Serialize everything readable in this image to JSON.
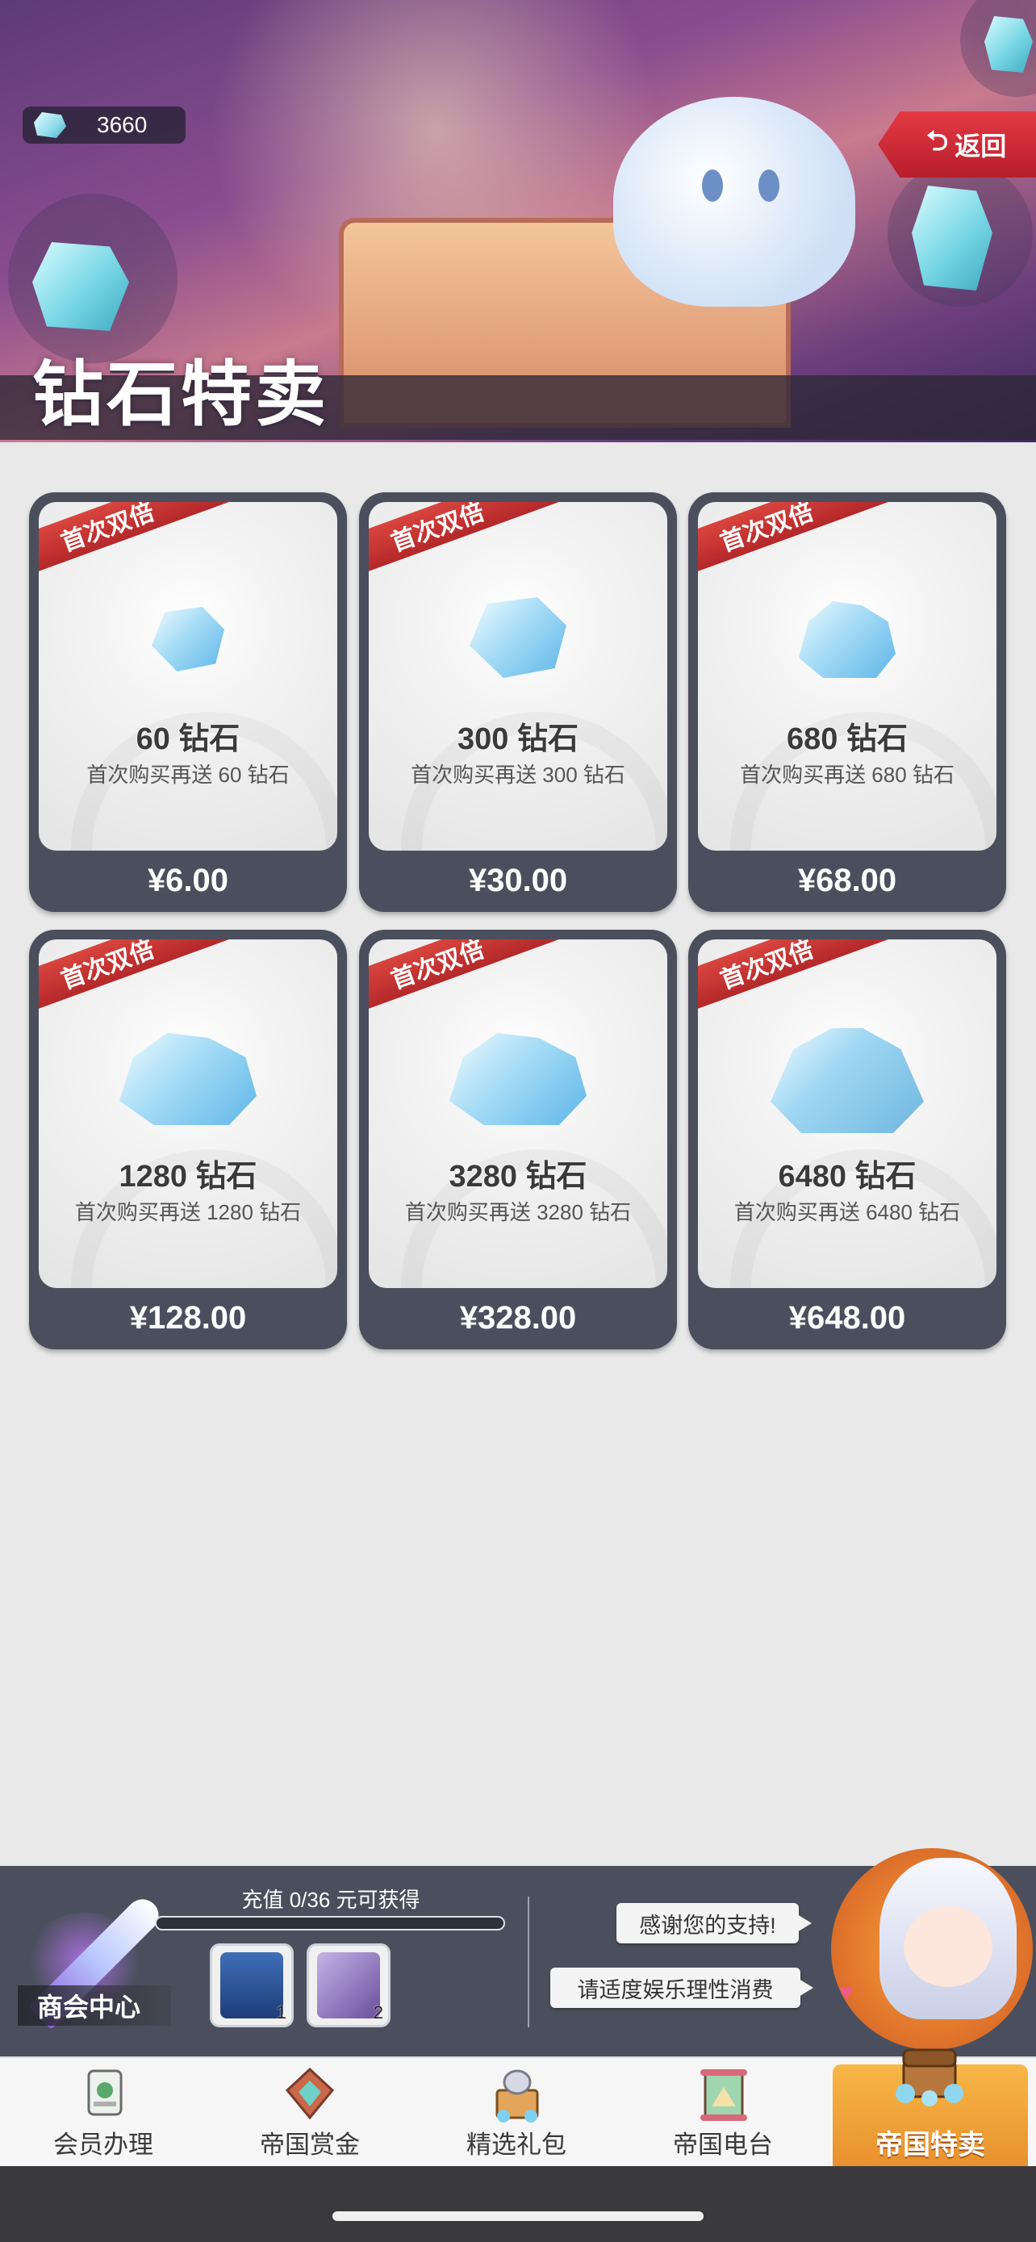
{
  "header": {
    "title": "钻石特卖",
    "balance": "3660",
    "back_label": "返回",
    "back_icon": "return-arrow-icon"
  },
  "products": [
    {
      "ribbon": "首次双倍",
      "amount": "60 钻石",
      "bonus": "首次购买再送 60 钻石",
      "price": "¥6.00"
    },
    {
      "ribbon": "首次双倍",
      "amount": "300 钻石",
      "bonus": "首次购买再送 300 钻石",
      "price": "¥30.00"
    },
    {
      "ribbon": "首次双倍",
      "amount": "680 钻石",
      "bonus": "首次购买再送 680 钻石",
      "price": "¥68.00"
    },
    {
      "ribbon": "首次双倍",
      "amount": "1280 钻石",
      "bonus": "首次购买再送 1280 钻石",
      "price": "¥128.00"
    },
    {
      "ribbon": "首次双倍",
      "amount": "3280 钻石",
      "bonus": "首次购买再送 3280 钻石",
      "price": "¥328.00"
    },
    {
      "ribbon": "首次双倍",
      "amount": "6480 钻石",
      "bonus": "首次购买再送 6480 钻石",
      "price": "¥648.00"
    }
  ],
  "promo": {
    "shop_label": "商会中心",
    "recharge_text": "充值 0/36 元可获得",
    "progress_fraction": 0,
    "rewards": [
      {
        "count": "1",
        "icon": "armor-card-icon"
      },
      {
        "count": "2",
        "icon": "scroll-card-icon"
      }
    ],
    "bubble_thanks": "感谢您的支持!",
    "bubble_notice": "请适度娱乐理性消费"
  },
  "tabs": [
    {
      "label": "会员办理",
      "icon": "membership-card-icon"
    },
    {
      "label": "帝国赏金",
      "icon": "bounty-emblem-icon"
    },
    {
      "label": "精选礼包",
      "icon": "gift-pack-icon"
    },
    {
      "label": "帝国电台",
      "icon": "scroll-banner-icon"
    },
    {
      "label": "帝国特卖",
      "icon": "treasure-chest-icon",
      "active": true
    }
  ],
  "colors": {
    "accent_red": "#c6302f",
    "card_frame": "#4b4f5d",
    "active_tab": "#f0a63a",
    "page_bg": "#e9e9ea"
  }
}
